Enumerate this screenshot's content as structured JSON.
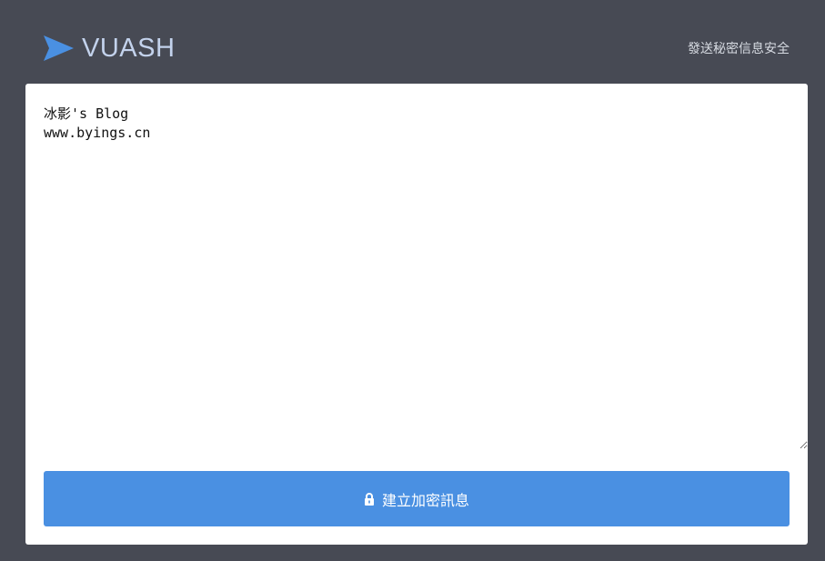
{
  "header": {
    "brand_name": "VUASH",
    "brand_icon": "paper-plane-icon",
    "tagline": "發送秘密信息安全"
  },
  "editor": {
    "message_value": "冰影's Blog\nwww.byings.cn"
  },
  "actions": {
    "create_label": "建立加密訊息",
    "create_icon": "lock-icon"
  },
  "colors": {
    "background": "#474a54",
    "brand_accent": "#4a90e2",
    "brand_text": "#c3d2ec",
    "card": "#ffffff"
  }
}
